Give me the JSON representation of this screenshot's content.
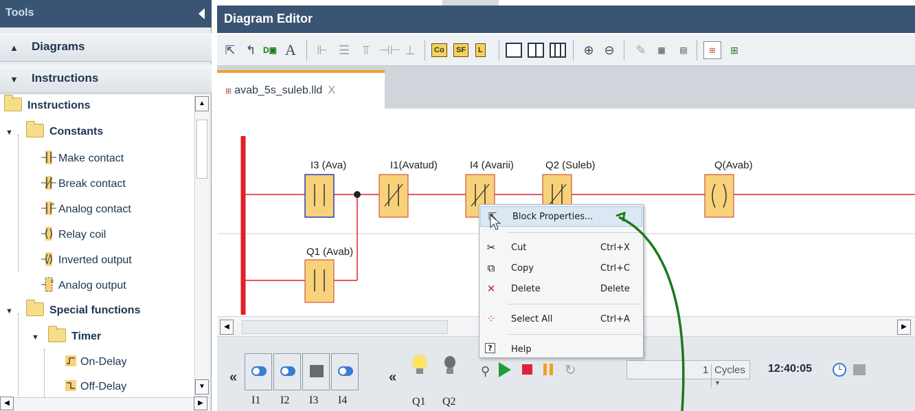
{
  "tools": {
    "title": "Tools",
    "accordion": [
      {
        "label": "Diagrams",
        "state": "collapsed"
      },
      {
        "label": "Instructions",
        "state": "expanded"
      }
    ],
    "tree": {
      "root": "Instructions",
      "constants": {
        "label": "Constants",
        "items": [
          "Make contact",
          "Break contact",
          "Analog contact",
          "Relay coil",
          "Inverted output",
          "Analog output"
        ]
      },
      "special": {
        "label": "Special functions",
        "timer": {
          "label": "Timer",
          "items": [
            "On-Delay",
            "Off-Delay"
          ]
        }
      }
    }
  },
  "editor": {
    "title": "Diagram Editor",
    "toolbar": {
      "co": "Co",
      "sf": "SF",
      "l": "L"
    },
    "tab": {
      "label": "avab_5s_suleb.lld",
      "close": "X"
    },
    "diagram": {
      "blocks": [
        {
          "label": "I3 (Ava)",
          "kind": "make-contact"
        },
        {
          "label": "I1(Avatud)",
          "kind": "break-contact"
        },
        {
          "label": "I4 (Avarii)",
          "kind": "break-contact"
        },
        {
          "label": "Q2 (Suleb)",
          "kind": "break-contact"
        },
        {
          "label": "Q(Avab)",
          "kind": "relay-coil"
        },
        {
          "label": "Q1 (Avab)",
          "kind": "make-contact"
        }
      ]
    },
    "simulation": {
      "inputs": [
        "I1",
        "I2",
        "I3",
        "I4"
      ],
      "outputs": [
        "Q1",
        "Q2"
      ],
      "cycles_value": "1",
      "cycles_label": "Cycles",
      "time": "12:40:05",
      "collapse_glyph": "«"
    }
  },
  "context_menu": {
    "items": [
      {
        "label": "Block Properties...",
        "shortcut": "",
        "icon": "cursor-icon",
        "highlighted": true
      },
      {
        "label": "Cut",
        "shortcut": "Ctrl+X",
        "icon": "scissors-icon"
      },
      {
        "label": "Copy",
        "shortcut": "Ctrl+C",
        "icon": "copy-icon"
      },
      {
        "label": "Delete",
        "shortcut": "Delete",
        "icon": "delete-x-icon"
      },
      {
        "label": "Select All",
        "shortcut": "Ctrl+A",
        "icon": "select-all-icon"
      },
      {
        "label": "Help",
        "shortcut": "",
        "icon": "help-icon"
      }
    ]
  },
  "colors": {
    "title_bar": "#3a5573",
    "rung_line": "#e0202a",
    "block_fill": "#f8d27a",
    "tab_accent": "#f0a030",
    "annotation_arrow": "#1a7a1a"
  }
}
